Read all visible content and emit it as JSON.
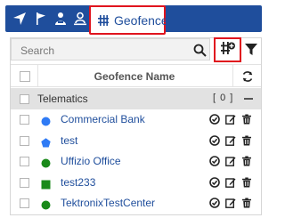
{
  "tabs": [
    {
      "icon": "location-arrow-icon"
    },
    {
      "icon": "flag-icon"
    },
    {
      "icon": "driver-icon"
    },
    {
      "icon": "user-location-icon"
    },
    {
      "icon": "geofence-icon",
      "label": "Geofence",
      "active": true
    }
  ],
  "search": {
    "placeholder": "Search"
  },
  "column_header": {
    "title": "Geofence Name"
  },
  "group": {
    "name": "Telematics",
    "count": "[ 0 ]"
  },
  "geofences": [
    {
      "name": "Commercial Bank",
      "shape": "circle",
      "color": "#2f7bf5"
    },
    {
      "name": "test",
      "shape": "polygon",
      "color": "#2f7bf5"
    },
    {
      "name": "Uffizio Office",
      "shape": "circle",
      "color": "#1a8a1a"
    },
    {
      "name": "test233",
      "shape": "square",
      "color": "#1a8a1a"
    },
    {
      "name": "TektronixTestCenter",
      "shape": "circle",
      "color": "#1a8a1a"
    }
  ],
  "colors": {
    "brand": "#1f4e9c",
    "highlight": "#e0141e",
    "group_bg": "#e2e2e2"
  }
}
